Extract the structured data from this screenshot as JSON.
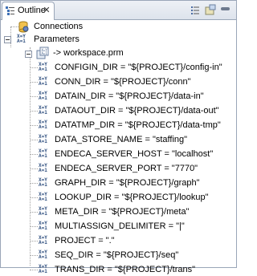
{
  "tab": {
    "title": "Outline",
    "close_glyph": "✕",
    "icon": "outline-icon"
  },
  "toolbar": {
    "sort_icon": "sort-icon",
    "filter_icon": "filter-icon",
    "minimize_icon": "minimize-icon"
  },
  "tree": {
    "connections": {
      "label": "Connections",
      "icon": "connections-db-icon"
    },
    "parameters": {
      "label": "Parameters",
      "icon": "parameters-xy-icon"
    },
    "workspace": {
      "label": "-> workspace.prm",
      "icon": "parameter-file-icon"
    },
    "params": [
      {
        "label": "CONFIGIN_DIR = \"${PROJECT}/config-in\""
      },
      {
        "label": "CONN_DIR = \"${PROJECT}/conn\""
      },
      {
        "label": "DATAIN_DIR = \"${PROJECT}/data-in\""
      },
      {
        "label": "DATAOUT_DIR = \"${PROJECT}/data-out\""
      },
      {
        "label": "DATATMP_DIR = \"${PROJECT}/data-tmp\""
      },
      {
        "label": "DATA_STORE_NAME = \"staffing\""
      },
      {
        "label": "ENDECA_SERVER_HOST = \"localhost\""
      },
      {
        "label": "ENDECA_SERVER_PORT = \"7770\""
      },
      {
        "label": "GRAPH_DIR = \"${PROJECT}/graph\""
      },
      {
        "label": "LOOKUP_DIR = \"${PROJECT}/lookup\""
      },
      {
        "label": "META_DIR = \"${PROJECT}/meta\""
      },
      {
        "label": "MULTIASSIGN_DELIMITER = \"|\""
      },
      {
        "label": "PROJECT = \".\""
      },
      {
        "label": "SEQ_DIR = \"${PROJECT}/seq\""
      },
      {
        "label": "TRANS_DIR = \"${PROJECT}/trans\""
      }
    ],
    "xy_top": "X=Y",
    "xy_bottom": "A=1"
  },
  "colors": {
    "accent": "#2f4f7f",
    "border": "#9aa6b8",
    "tab_bg": "#dde3ec"
  }
}
